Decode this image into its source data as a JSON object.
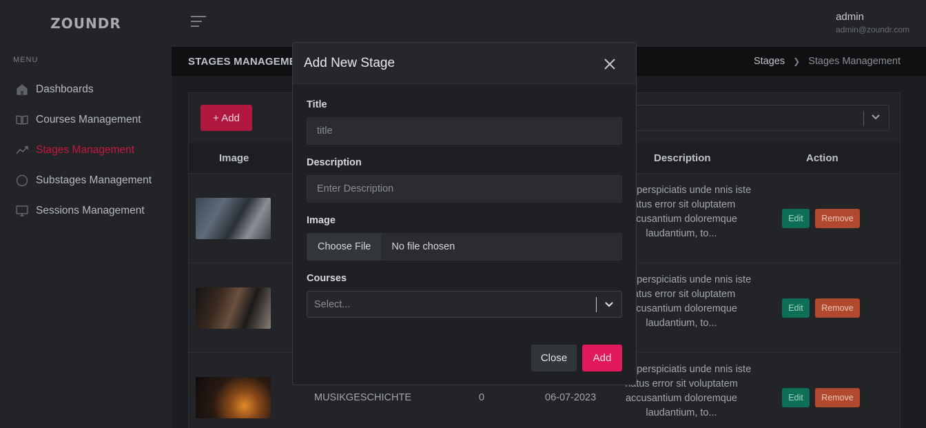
{
  "app": {
    "logo": "ZOUNDR"
  },
  "sidebar": {
    "menu_title": "MENU",
    "items": [
      {
        "label": "Dashboards",
        "icon": "home-icon"
      },
      {
        "label": "Courses Management",
        "icon": "book-icon"
      },
      {
        "label": "Stages Management",
        "icon": "trend-icon",
        "active": true
      },
      {
        "label": "Substages Management",
        "icon": "circle-icon"
      },
      {
        "label": "Sessions Management",
        "icon": "monitor-icon"
      }
    ]
  },
  "topbar": {
    "user_name": "admin",
    "user_email": "admin@zoundr.com"
  },
  "page": {
    "title": "STAGES MANAGEMENT",
    "breadcrumb": [
      "Stages",
      "Stages Management"
    ]
  },
  "toolbar": {
    "add_label": "+ Add"
  },
  "table": {
    "columns": {
      "image": "Image",
      "description": "Description",
      "action": "Action"
    },
    "rows": [
      {
        "title": "",
        "count": "",
        "date": "",
        "description": "ed ut perspiciatis unde nnis iste natus error sit oluptatem accusantium doloremque laudantium, to...",
        "edit": "Edit",
        "remove": "Remove"
      },
      {
        "title": "",
        "count": "",
        "date": "",
        "description": "ed ut perspiciatis unde nnis iste natus error sit oluptatem accusantium doloremque laudantium, to...",
        "edit": "Edit",
        "remove": "Remove"
      },
      {
        "title": "MUSIKGESCHICHTE",
        "count": "0",
        "date": "06-07-2023",
        "description": "ed ut perspiciatis unde nnis iste natus error sit voluptatem accusantium doloremque laudantium, to...",
        "edit": "Edit",
        "remove": "Remove"
      }
    ]
  },
  "modal": {
    "title": "Add New Stage",
    "fields": {
      "title_label": "Title",
      "title_placeholder": "title",
      "description_label": "Description",
      "description_placeholder": "Enter Description",
      "image_label": "Image",
      "choose_file": "Choose File",
      "no_file": "No file chosen",
      "courses_label": "Courses",
      "courses_placeholder": "Select..."
    },
    "close_label": "Close",
    "add_label": "Add"
  },
  "colors": {
    "accent": "#b0183f",
    "modal_add": "#e0195b",
    "edit": "#0d6f56",
    "remove": "#b0492e"
  }
}
